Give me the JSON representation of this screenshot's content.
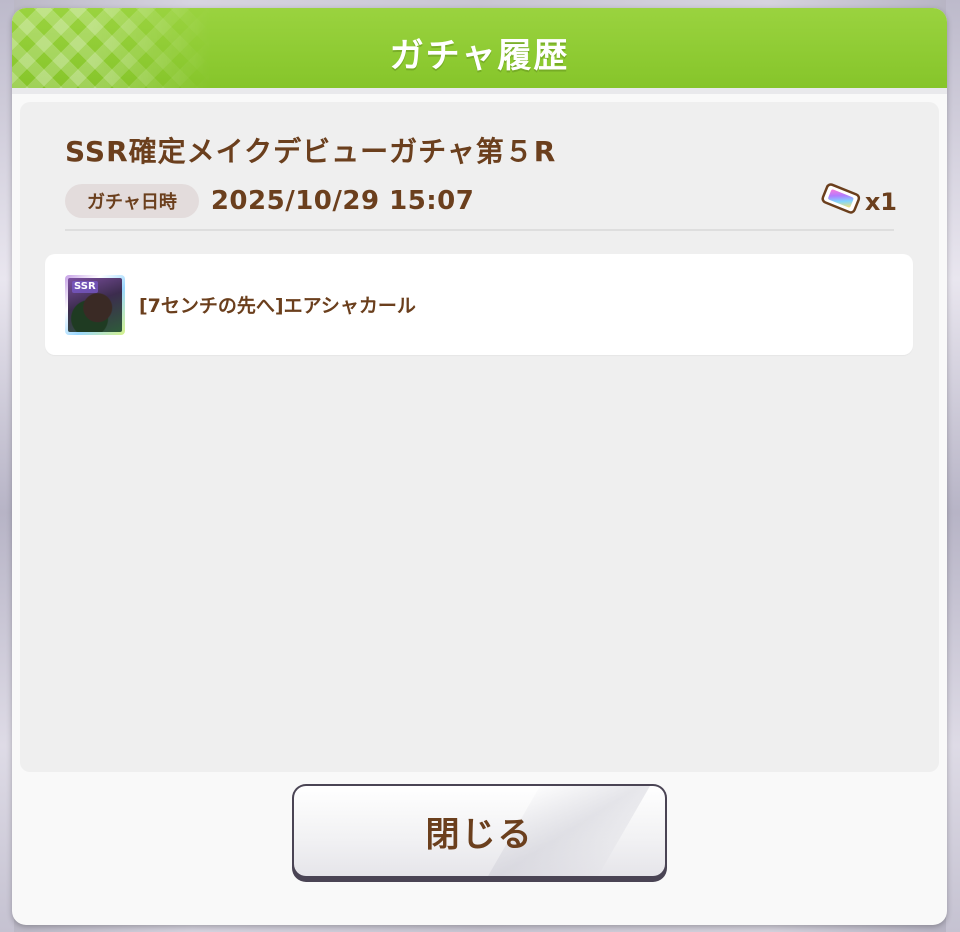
{
  "dialog": {
    "title": "ガチャ履歴",
    "gacha_name": "SSR確定メイクデビューガチャ第５R",
    "date_label": "ガチャ日時",
    "date_value": "2025/10/29 15:07",
    "ticket_icon": "rainbow-ticket-icon",
    "ticket_count": "x1",
    "results": [
      {
        "rarity": "SSR",
        "card_icon": "support-card-thumbnail",
        "name": "[7センチの先へ]エアシャカール"
      }
    ],
    "close_label": "閉じる"
  },
  "colors": {
    "header_green": "#8ccb30",
    "text_brown": "#6b3f1d",
    "panel_gray": "#efefef"
  }
}
